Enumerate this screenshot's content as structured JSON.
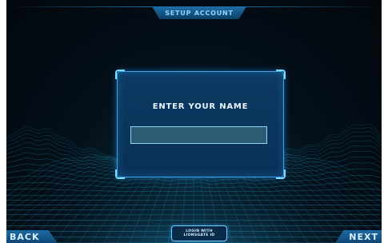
{
  "header": {
    "title": "SETUP ACCOUNT"
  },
  "dialog": {
    "heading": "ENTER YOUR NAME",
    "name_input": {
      "value": "",
      "placeholder": ""
    }
  },
  "footer": {
    "back_label": "BACK",
    "next_label": "NEXT",
    "lionsgate_label": "LOGIN WITH\nLIONSGATE ID"
  },
  "colors": {
    "accent": "#3aa3e6",
    "panel": "#0c3a63",
    "grid": "#1f8fb0"
  }
}
